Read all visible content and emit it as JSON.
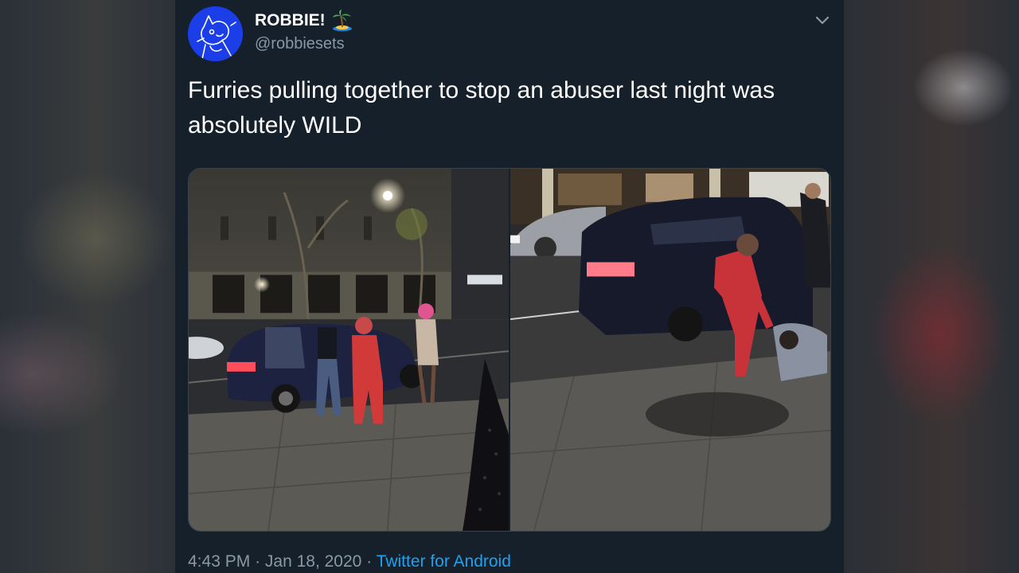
{
  "author": {
    "display_name": "ROBBIE!",
    "handle": "@robbiesets",
    "avatar_icon": "cartoon-avatar",
    "badge_icon": "desert-island-icon"
  },
  "tweet": {
    "text": "Furries pulling together to stop an abuser last night was absolutely WILD"
  },
  "media": {
    "count": 2,
    "items": [
      {
        "icon": "photo-street-crowd"
      },
      {
        "icon": "photo-sidewalk-scuffle"
      }
    ]
  },
  "meta": {
    "time": "4:43 PM",
    "separator": "·",
    "date": "Jan 18, 2020",
    "source": "Twitter for Android"
  },
  "colors": {
    "background": "#15202b",
    "text": "#ffffff",
    "secondary": "#8899a6",
    "link": "#1da1f2",
    "avatar": "#1b3ee8"
  }
}
